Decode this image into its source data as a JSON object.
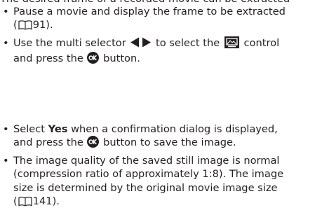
{
  "intro": "The desired frame of a recorded movie can be extracted",
  "bullet_char": "•",
  "items": [
    {
      "line1": "Pause a movie and display the frame to be extracted",
      "line2_open": "(",
      "ref": "91",
      "line2_close": ")."
    },
    {
      "line1_a": "Use the multi selector",
      "line1_b": "to select the",
      "line1_c": "control",
      "line2_a": "and press the",
      "line2_b": "button."
    },
    {
      "line1_a": "Select",
      "line1_bold": "Yes",
      "line1_b": "when a confirmation dialog is displayed,",
      "line2_a": "and press the",
      "line2_b": "button to save the image."
    },
    {
      "line1": "The image quality of the saved still image is normal",
      "line2": "(compression ratio of approximately 1:8). The image",
      "line3": "size is determined by the original movie image size",
      "line4_open": "(",
      "ref": "141",
      "line4_close": ")."
    }
  ],
  "icons": {
    "book": "page-reference-book-icon",
    "arrows": "multi-selector-left-right-icon",
    "extract": "extract-frame-control-icon",
    "ok": "ok-button-icon"
  }
}
